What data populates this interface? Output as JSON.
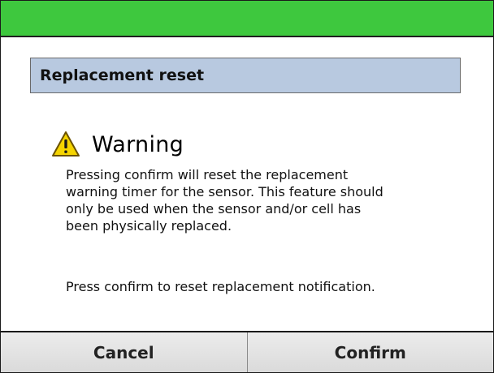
{
  "colors": {
    "top_bar": "#3ec83e",
    "header_bg": "#b8c9e0",
    "warning_yellow": "#f5d400",
    "button_bg": "#e6e6e6"
  },
  "header": {
    "title": "Replacement reset"
  },
  "warning": {
    "icon": "warning-triangle-icon",
    "title": "Warning",
    "body_lines": [
      "Pressing confirm will reset the replacement",
      "warning timer for the sensor. This feature should",
      "only be used when the sensor and/or cell has",
      "been physically replaced."
    ],
    "instruction": "Press confirm to reset replacement notification."
  },
  "buttons": {
    "cancel_label": "Cancel",
    "confirm_label": "Confirm"
  }
}
